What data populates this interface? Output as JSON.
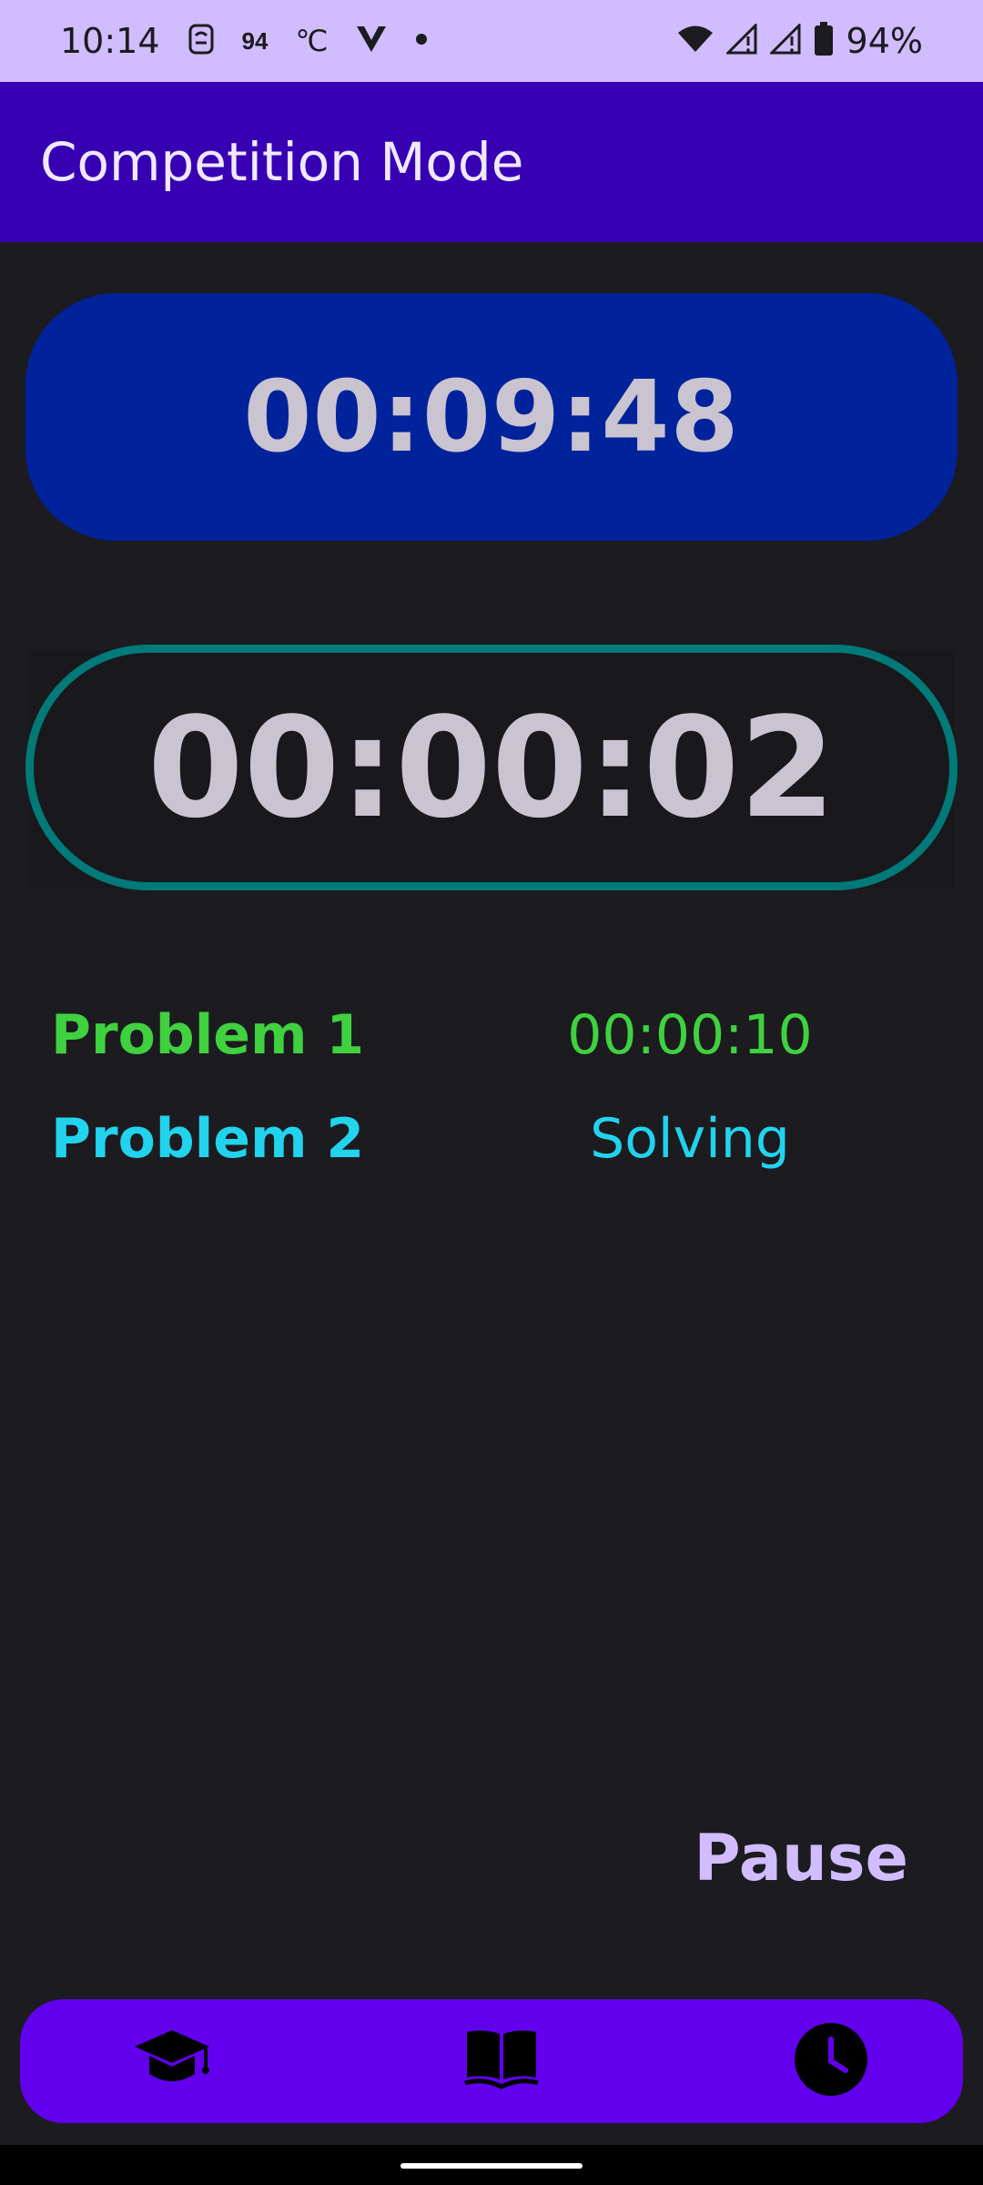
{
  "status_bar": {
    "time": "10:14",
    "temp_value": "94",
    "temp_unit": "℃",
    "battery_text": "94%",
    "icons": [
      "sim-icon",
      "vpn-icon",
      "dot-icon",
      "wifi-icon",
      "signal-icon",
      "signal-icon",
      "battery-icon"
    ]
  },
  "app_bar": {
    "title": "Competition Mode"
  },
  "timers": {
    "total": "00:09:48",
    "current_problem": "00:00:02",
    "ring_color": "#007a78",
    "total_bg_color": "#00229a"
  },
  "problems": [
    {
      "name": "Problem 1",
      "status": "00:00:10",
      "color": "#3fd13f"
    },
    {
      "name": "Problem 2",
      "status": "Solving",
      "color": "#22d3ee"
    }
  ],
  "actions": {
    "pause_label": "Pause"
  },
  "bottom_nav": {
    "items": [
      {
        "icon": "graduation-cap-icon"
      },
      {
        "icon": "open-book-icon"
      },
      {
        "icon": "clock-icon"
      }
    ],
    "bg_color": "#6200ee"
  },
  "colors": {
    "app_bar": "#3700b3",
    "status_bar": "#d0bcff",
    "background": "#1c1b1f"
  }
}
